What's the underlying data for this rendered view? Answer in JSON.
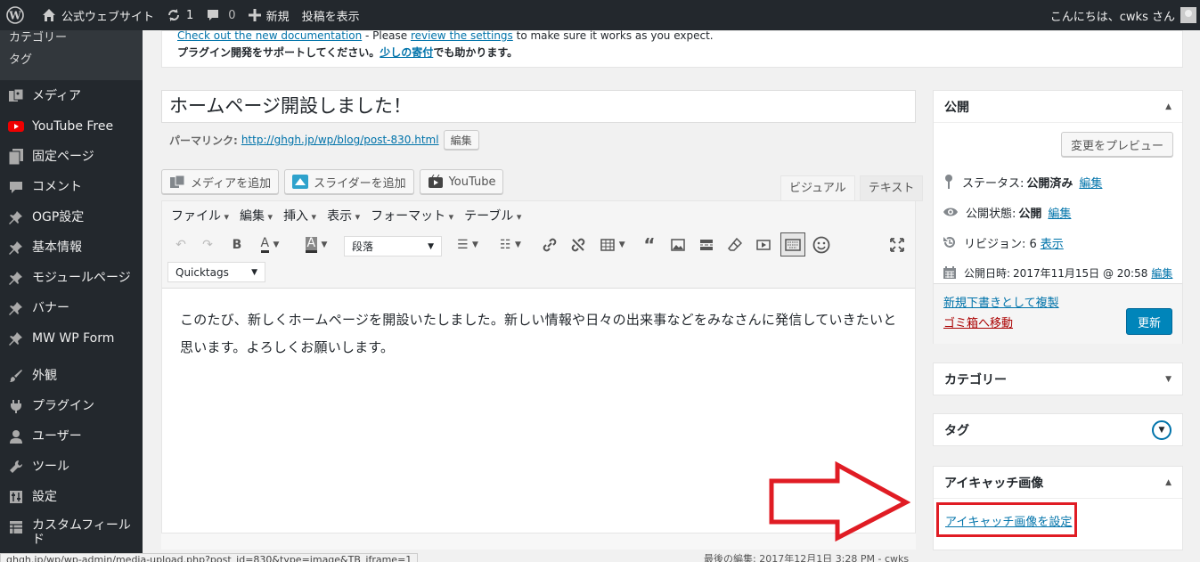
{
  "adminbar": {
    "site_name": "公式ウェブサイト",
    "updates_count": "1",
    "comments_count": "0",
    "new_label": "新規",
    "view_post": "投稿を表示",
    "greeting": "こんにちは、cwks さん"
  },
  "sidebar": {
    "submenu": [
      "カテゴリー",
      "タグ"
    ],
    "items": [
      {
        "label": "メディア",
        "icon": "media-icon"
      },
      {
        "label": "YouTube Free",
        "icon": "youtube-icon"
      },
      {
        "label": "固定ページ",
        "icon": "page-icon"
      },
      {
        "label": "コメント",
        "icon": "comment-icon"
      },
      {
        "label": "OGP設定",
        "icon": "pin-icon"
      },
      {
        "label": "基本情報",
        "icon": "pin-icon"
      },
      {
        "label": "モジュールページ",
        "icon": "pin-icon"
      },
      {
        "label": "バナー",
        "icon": "pin-icon"
      },
      {
        "label": "MW WP Form",
        "icon": "pin-icon"
      },
      {
        "label": "外観",
        "icon": "brush-icon"
      },
      {
        "label": "プラグイン",
        "icon": "plugin-icon"
      },
      {
        "label": "ユーザー",
        "icon": "user-icon"
      },
      {
        "label": "ツール",
        "icon": "wrench-icon"
      },
      {
        "label": "設定",
        "icon": "settings-icon"
      },
      {
        "label": "カスタムフィールド",
        "icon": "grid-icon"
      }
    ]
  },
  "notice": {
    "link1": "Check out the new documentation",
    "text1": " - Please ",
    "link2": "review the settings",
    "text2": " to make sure it works as you expect.",
    "support": "プラグイン開発をサポートしてください。",
    "donate": "少しの寄付",
    "support2": "でも助かります。"
  },
  "post": {
    "title": "ホームページ開設しました！",
    "permalink_label": "パーマリンク:",
    "permalink_url": "http://ghgh.jp/wp/blog/post-830.html",
    "permalink_edit": "編集",
    "body": "このたび、新しくホームページを開設いたしました。新しい情報や日々の出来事などをみなさんに発信していきたいと思います。よろしくお願いします。"
  },
  "media_buttons": [
    "メディアを追加",
    "スライダーを追加",
    "YouTube"
  ],
  "editor_tabs": [
    "ビジュアル",
    "テキスト"
  ],
  "menubar": [
    "ファイル",
    "編集",
    "挿入",
    "表示",
    "フォーマット",
    "テーブル"
  ],
  "toolbar": {
    "format_select": "段落",
    "quicktags_select": "Quicktags"
  },
  "status": {
    "last_edit": "最後の編集: 2017年12月1日 3:28 PM - cwks",
    "url": "ghgh.jp/wp/wp-admin/media-upload.php?post_id=830&type=image&TB_iframe=1"
  },
  "publish": {
    "title": "公開",
    "preview": "変更をプレビュー",
    "status_label": "ステータス:",
    "status_value": "公開済み",
    "visibility_label": "公開状態:",
    "visibility_value": "公開",
    "revision_label": "リビジョン: 6",
    "revision_link": "表示",
    "date_label": "公開日時:",
    "date_value": "2017年11月15日 @ 20:58",
    "edit": "編集",
    "duplicate": "新規下書きとして複製",
    "trash": "ゴミ箱へ移動",
    "update": "更新"
  },
  "boxes": {
    "category": "カテゴリー",
    "tag": "タグ",
    "thumbnail": "アイキャッチ画像",
    "thumbnail_link": "アイキャッチ画像を設定"
  },
  "colors": {
    "adminbar": "#23282d",
    "link": "#0073aa",
    "primary": "#0085ba",
    "trash": "#a00",
    "highlight": "#e01c24"
  }
}
